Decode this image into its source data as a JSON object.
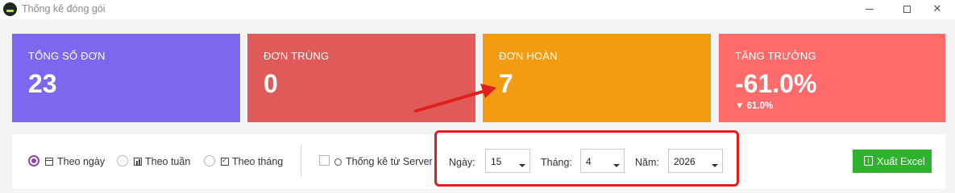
{
  "window": {
    "title": "Thống kê đóng gói"
  },
  "cards": [
    {
      "label": "TỔNG SỐ ĐƠN",
      "value": "23",
      "color": "#7b68ee"
    },
    {
      "label": "ĐƠN TRÙNG",
      "value": "0",
      "color": "#e05a5a"
    },
    {
      "label": "ĐƠN HOÀN",
      "value": "7",
      "color": "#f39c12"
    },
    {
      "label": "TĂNG TRƯỞNG",
      "value": "-61.0%",
      "sub": "▼ 61.0%",
      "color": "#ff6b6b"
    }
  ],
  "filters": {
    "options": [
      {
        "label": "Theo ngày",
        "icon": "calendar-icon",
        "checked": true
      },
      {
        "label": "Theo tuần",
        "icon": "bar-chart-icon",
        "checked": false
      },
      {
        "label": "Theo tháng",
        "icon": "checklist-icon",
        "checked": false
      }
    ],
    "server": {
      "label": "Thống kê từ Server",
      "icon": "server-icon",
      "checked": false
    },
    "day": {
      "label": "Ngày:",
      "value": "15"
    },
    "month": {
      "label": "Tháng:",
      "value": "4"
    },
    "year": {
      "label": "Năm:",
      "value": "2026"
    },
    "export": {
      "label": "Xuất Excel",
      "icon": "export-icon"
    }
  },
  "annotations": {
    "highlight_color": "#e01e1e",
    "arrow_color": "#e01e1e"
  }
}
